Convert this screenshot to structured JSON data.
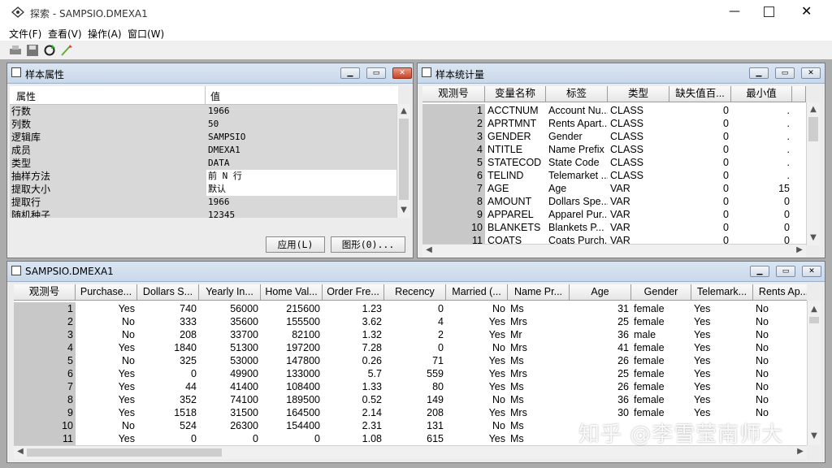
{
  "window": {
    "title": "探索 - SAMPSIO.DMEXA1",
    "controls": [
      "minimize-icon",
      "maximize-icon",
      "close-icon"
    ]
  },
  "menu": [
    "文件(F)",
    "查看(V)",
    "操作(A)",
    "窗口(W)"
  ],
  "toolbar": [
    "print-icon",
    "save-icon",
    "refresh-icon",
    "wizard-icon"
  ],
  "props": {
    "title": "样本属性",
    "headers": [
      "属性",
      "值"
    ],
    "rows": [
      {
        "k": "行数",
        "v": "1966"
      },
      {
        "k": "列数",
        "v": "50"
      },
      {
        "k": "逻辑库",
        "v": "SAMPSIO"
      },
      {
        "k": "成员",
        "v": "DMEXA1"
      },
      {
        "k": "类型",
        "v": "DATA"
      },
      {
        "k": "抽样方法",
        "v": "前 N 行"
      },
      {
        "k": "提取大小",
        "v": "默认"
      },
      {
        "k": "提取行",
        "v": "1966"
      },
      {
        "k": "随机种子",
        "v": "12345"
      }
    ],
    "apply_label": "应用(L)",
    "graph_label": "图形(0)..."
  },
  "stats": {
    "title": "样本统计量",
    "headers": [
      "观测号",
      "变量名称",
      "标签",
      "类型",
      "缺失值百...",
      "最小值"
    ],
    "rows": [
      [
        "1",
        "ACCTNUM",
        "Account Nu...",
        "CLASS",
        "0",
        "."
      ],
      [
        "2",
        "APRTMNT",
        "Rents Apart...",
        "CLASS",
        "0",
        "."
      ],
      [
        "3",
        "GENDER",
        "Gender",
        "CLASS",
        "0",
        "."
      ],
      [
        "4",
        "NTITLE",
        "Name Prefix",
        "CLASS",
        "0",
        "."
      ],
      [
        "5",
        "STATECOD",
        "State Code",
        "CLASS",
        "0",
        "."
      ],
      [
        "6",
        "TELIND",
        "Telemarket ...",
        "CLASS",
        "0",
        "."
      ],
      [
        "7",
        "AGE",
        "Age",
        "VAR",
        "0",
        "15"
      ],
      [
        "8",
        "AMOUNT",
        "Dollars Spe...",
        "VAR",
        "0",
        "0"
      ],
      [
        "9",
        "APPAREL",
        "Apparel Pur...",
        "VAR",
        "0",
        "0"
      ],
      [
        "10",
        "BLANKETS",
        "Blankets P...",
        "VAR",
        "0",
        "0"
      ],
      [
        "11",
        "COATS",
        "Coats Purch...",
        "VAR",
        "0",
        "0"
      ]
    ]
  },
  "data": {
    "title": "SAMPSIO.DMEXA1",
    "headers": [
      "观测号",
      "Purchase...",
      "Dollars S...",
      "Yearly In...",
      "Home Val...",
      "Order Fre...",
      "Recency",
      "Married (...",
      "Name Pr...",
      "Age",
      "Gender",
      "Telemark...",
      "Rents Ap..."
    ],
    "rows": [
      [
        "1",
        "Yes",
        "740",
        "56000",
        "215600",
        "1.23",
        "0",
        "No",
        "Ms",
        "31",
        "female",
        "Yes",
        "No"
      ],
      [
        "2",
        "No",
        "333",
        "35600",
        "155500",
        "3.62",
        "4",
        "Yes",
        "Mrs",
        "25",
        "female",
        "Yes",
        "No"
      ],
      [
        "3",
        "No",
        "208",
        "33700",
        "82100",
        "1.32",
        "2",
        "Yes",
        "Mr",
        "36",
        "male",
        "Yes",
        "No"
      ],
      [
        "4",
        "Yes",
        "1840",
        "51300",
        "197200",
        "7.28",
        "0",
        "No",
        "Mrs",
        "41",
        "female",
        "Yes",
        "No"
      ],
      [
        "5",
        "No",
        "325",
        "53000",
        "147800",
        "0.26",
        "71",
        "Yes",
        "Ms",
        "26",
        "female",
        "Yes",
        "No"
      ],
      [
        "6",
        "Yes",
        "0",
        "49900",
        "133000",
        "5.7",
        "559",
        "Yes",
        "Mrs",
        "25",
        "female",
        "Yes",
        "No"
      ],
      [
        "7",
        "Yes",
        "44",
        "41400",
        "108400",
        "1.33",
        "80",
        "Yes",
        "Ms",
        "26",
        "female",
        "Yes",
        "No"
      ],
      [
        "8",
        "Yes",
        "352",
        "74100",
        "189500",
        "0.52",
        "149",
        "No",
        "Ms",
        "36",
        "female",
        "Yes",
        "No"
      ],
      [
        "9",
        "Yes",
        "1518",
        "31500",
        "164500",
        "2.14",
        "208",
        "Yes",
        "Mrs",
        "30",
        "female",
        "Yes",
        "No"
      ],
      [
        "10",
        "No",
        "524",
        "26300",
        "154400",
        "2.31",
        "131",
        "No",
        "Ms",
        "",
        "",
        "",
        ""
      ],
      [
        "11",
        "Yes",
        "0",
        "0",
        "0",
        "1.08",
        "615",
        "Yes",
        "Ms",
        "",
        "",
        "",
        ""
      ]
    ]
  },
  "watermark": "知乎 @李雪莹南师大"
}
